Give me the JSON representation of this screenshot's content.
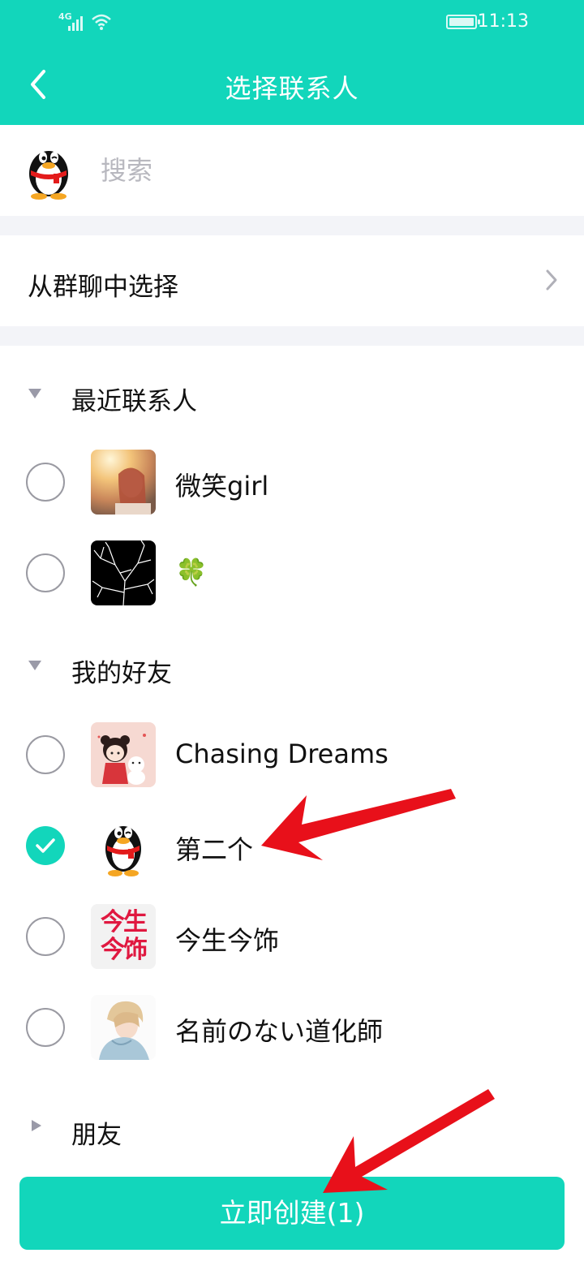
{
  "status_bar": {
    "network": "4G",
    "time": "11:13"
  },
  "header": {
    "title": "选择联系人"
  },
  "search": {
    "placeholder": "搜索"
  },
  "group_select": {
    "label": "从群聊中选择"
  },
  "sections": {
    "recent": {
      "label": "最近联系人",
      "expanded": true
    },
    "friends": {
      "label": "我的好友",
      "expanded": true
    },
    "pengyou": {
      "label": "朋友",
      "expanded": false
    }
  },
  "recent_contacts": [
    {
      "name": "微笑girl",
      "checked": false,
      "avatar": "portrait-photo"
    },
    {
      "name": "🍀",
      "checked": false,
      "avatar": "tree-branches"
    }
  ],
  "friend_contacts": [
    {
      "name": "Chasing Dreams",
      "checked": false,
      "avatar": "cartoon-girl-with-dog"
    },
    {
      "name": "第二个",
      "checked": true,
      "avatar": "qq-penguin"
    },
    {
      "name": "今生今饰",
      "checked": false,
      "avatar": "text-logo",
      "avatar_text": [
        "今生",
        "今饰"
      ]
    },
    {
      "name": "名前のない道化師",
      "checked": false,
      "avatar": "anime-boy"
    }
  ],
  "footer": {
    "create_label": "立即创建(1)"
  },
  "colors": {
    "accent": "#12d6bb",
    "divider": "#f3f4f8",
    "annotation_arrow": "#e8101a"
  }
}
